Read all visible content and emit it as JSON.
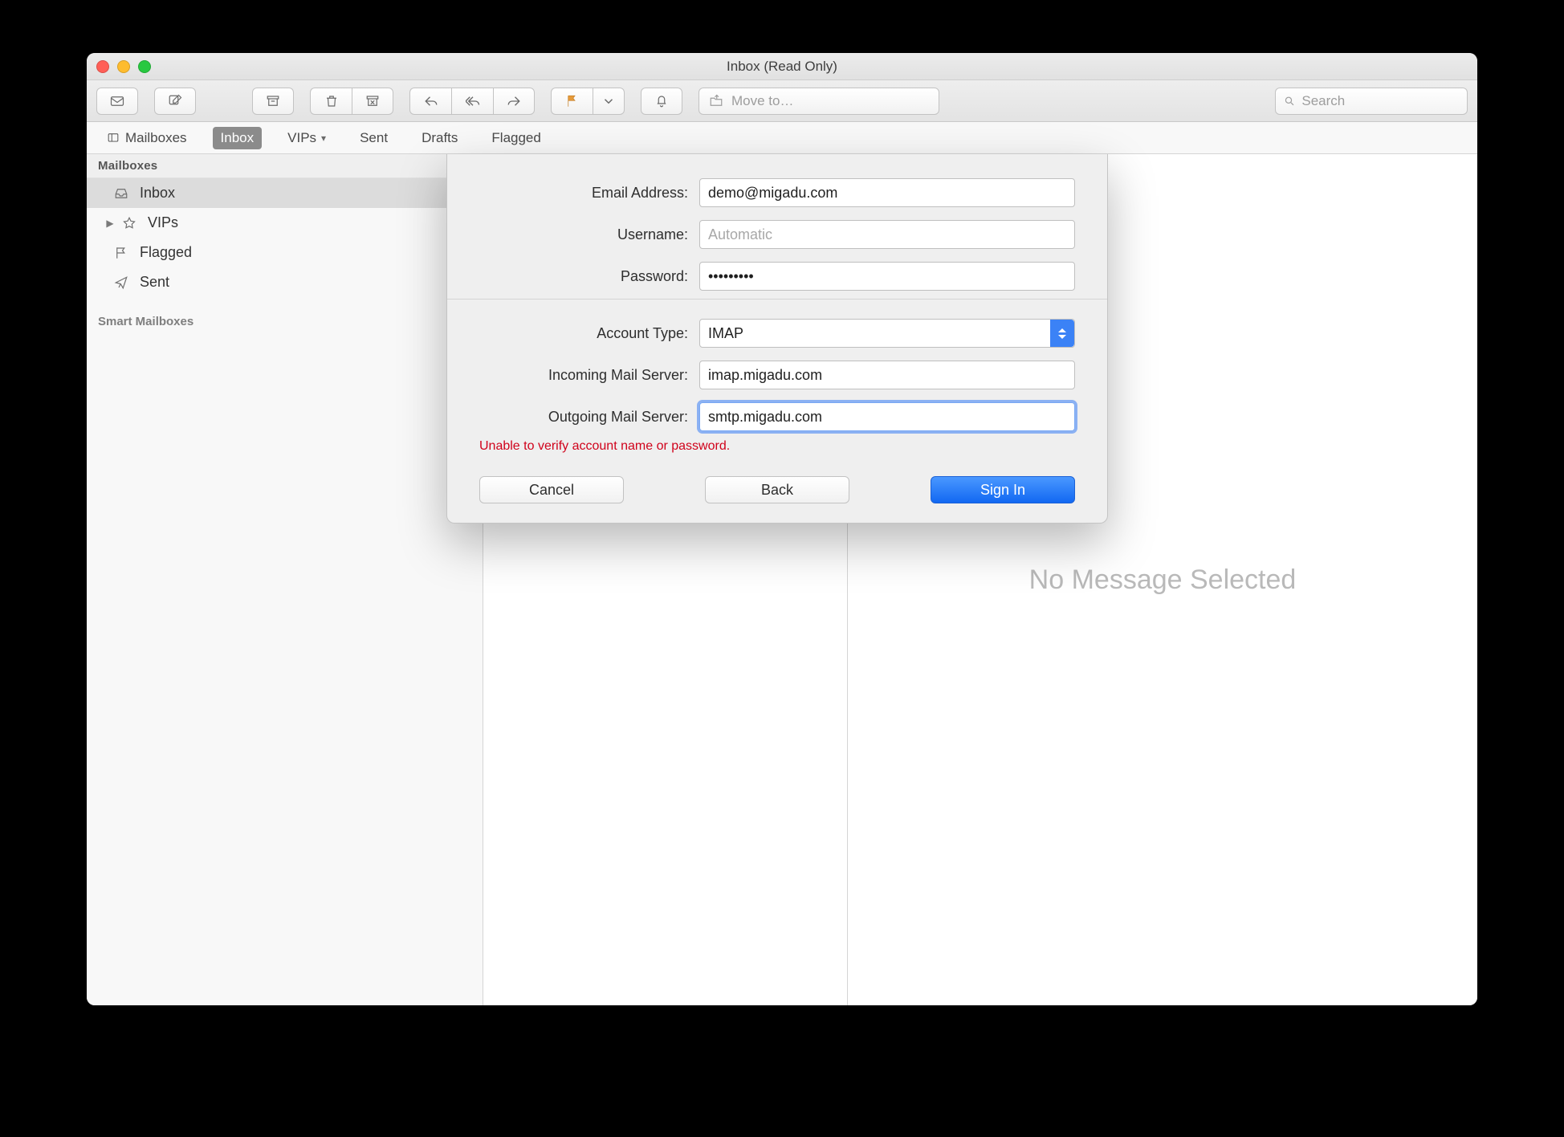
{
  "window": {
    "title": "Inbox (Read Only)"
  },
  "toolbar": {
    "move_placeholder": "Move to…",
    "search_placeholder": "Search"
  },
  "favbar": {
    "mailboxes": "Mailboxes",
    "inbox": "Inbox",
    "vips": "VIPs",
    "sent": "Sent",
    "drafts": "Drafts",
    "flagged": "Flagged"
  },
  "sidebar": {
    "section_mailboxes": "Mailboxes",
    "inbox": "Inbox",
    "vips": "VIPs",
    "flagged": "Flagged",
    "sent": "Sent",
    "smart_header": "Smart Mailboxes"
  },
  "viewer": {
    "placeholder": "No Message Selected"
  },
  "sheet": {
    "labels": {
      "email": "Email Address:",
      "username": "Username:",
      "password": "Password:",
      "account_type": "Account Type:",
      "incoming": "Incoming Mail Server:",
      "outgoing": "Outgoing Mail Server:"
    },
    "values": {
      "email": "demo@migadu.com",
      "username": "",
      "username_placeholder": "Automatic",
      "password": "•••••••••",
      "account_type": "IMAP",
      "incoming": "imap.migadu.com",
      "outgoing": "smtp.migadu.com"
    },
    "error": "Unable to verify account name or password.",
    "buttons": {
      "cancel": "Cancel",
      "back": "Back",
      "signin": "Sign In"
    }
  }
}
